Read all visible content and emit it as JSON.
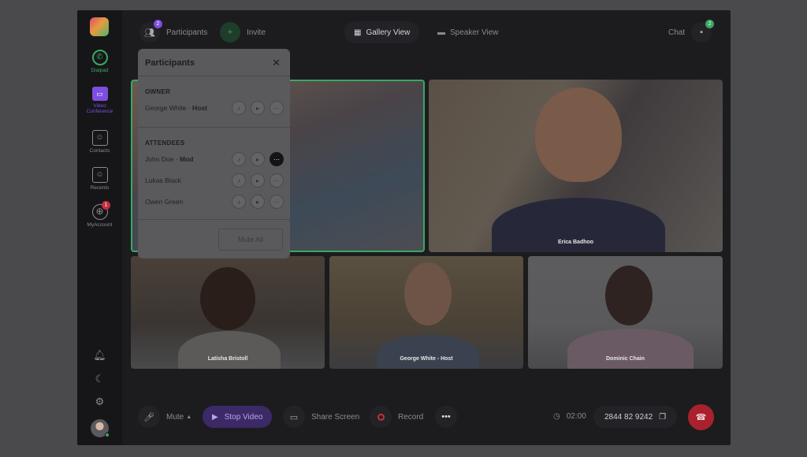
{
  "sidebar": {
    "items": [
      {
        "label": "Dialpad",
        "icon": "phone-icon"
      },
      {
        "label": "Video Conference",
        "icon": "video-icon"
      },
      {
        "label": "Contacts",
        "icon": "contacts-icon"
      },
      {
        "label": "Recents",
        "icon": "recents-icon"
      },
      {
        "label": "MyAccount",
        "icon": "globe-icon",
        "badge": "1"
      }
    ]
  },
  "topbar": {
    "participants_label": "Participants",
    "participants_count": "2",
    "invite_label": "Invite",
    "gallery_view_label": "Gallery View",
    "speaker_view_label": "Speaker View",
    "chat_label": "Chat",
    "chat_count": "2"
  },
  "tiles": [
    {
      "name": ""
    },
    {
      "name": "Erica Badhoo"
    },
    {
      "name": "Latisha Bristoll"
    },
    {
      "name": "George White - Host"
    },
    {
      "name": "Dominic Chain"
    }
  ],
  "participants_panel": {
    "title": "Participants",
    "owner_label": "OWNER",
    "owner": {
      "name": "George White",
      "sep": " · ",
      "role": "Host"
    },
    "attendees_label": "ATTENDEES",
    "attendees": [
      {
        "name": "John Doe",
        "sep": " · ",
        "role": "Mod"
      },
      {
        "name": "Lukas Black",
        "sep": "",
        "role": ""
      },
      {
        "name": "Owen Green",
        "sep": "",
        "role": ""
      }
    ],
    "mute_all_label": "Mute All"
  },
  "controls": {
    "mute_label": "Mute",
    "stop_video_label": "Stop Video",
    "share_screen_label": "Share Screen",
    "record_label": "Record",
    "timer": "02:00",
    "meeting_id": "2844 82 9242"
  },
  "colors": {
    "accent_green": "#3aa861",
    "accent_purple": "#7d4ee0",
    "end_call_red": "#c0303b"
  }
}
